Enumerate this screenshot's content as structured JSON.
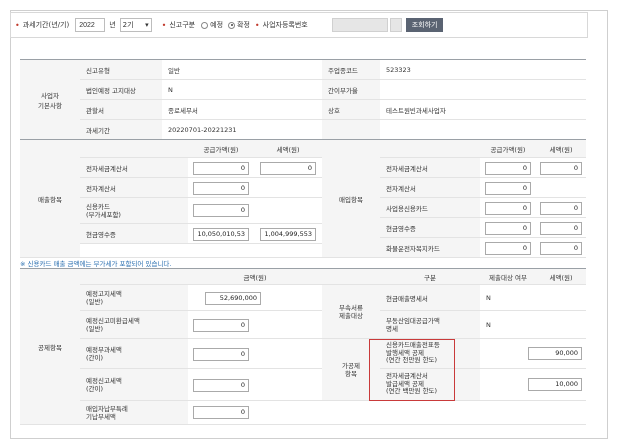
{
  "filter": {
    "period_label": "과세기간(년/기)",
    "year": "2022",
    "year_unit": "년",
    "term": "2기",
    "report_type_label": "신고구분",
    "radio_regular": "예정",
    "radio_confirm": "확정",
    "biz_no_label": "사업자등록번호",
    "search_button": "조회하기"
  },
  "basic": {
    "section_label": "사업자\n기본사항",
    "rows": [
      {
        "l1": "신고유형",
        "v1": "일반",
        "l2": "주업종코드",
        "v2": "523323"
      },
      {
        "l1": "법인예정 고지대상",
        "v1": "N",
        "l2": "간이부가율",
        "v2": ""
      },
      {
        "l1": "관할서",
        "v1": "종로세무서",
        "l2": "상호",
        "v2": "테스트원빈과세사업자"
      },
      {
        "l1": "과세기간",
        "v1": "20220701-20221231",
        "l2": "",
        "v2": ""
      }
    ]
  },
  "sales": {
    "section_label": "매출항목",
    "col_supply": "공급가액(원)",
    "col_tax": "세액(원)",
    "rows": [
      {
        "label": "전자세금계산서",
        "supply": "0",
        "tax": "0"
      },
      {
        "label": "전자계산서",
        "supply": "0",
        "tax": ""
      },
      {
        "label": "신용카드\n(부가세포함)",
        "supply": "0",
        "tax": ""
      },
      {
        "label": "현금영수증",
        "supply": "10,050,010,53",
        "tax": "1,004,999,553"
      }
    ]
  },
  "purchase": {
    "section_label": "매입항목",
    "col_supply": "공급가액(원)",
    "col_tax": "세액(원)",
    "rows": [
      {
        "label": "전자세금계산서",
        "supply": "0",
        "tax": "0"
      },
      {
        "label": "전자계산서",
        "supply": "0",
        "tax": ""
      },
      {
        "label": "사업용신용카드",
        "supply": "0",
        "tax": "0"
      },
      {
        "label": "현금영수증",
        "supply": "0",
        "tax": "0"
      },
      {
        "label": "화물운전자복지카드",
        "supply": "0",
        "tax": "0"
      }
    ]
  },
  "note": "※ 신용카드 매출 금액에는 부가세가 포함되어 있습니다.",
  "deduction": {
    "section_label": "공제항목",
    "col_amount": "금액(원)",
    "rows": [
      {
        "label": "예정고지세액\n(일반)",
        "value": "52,690,000"
      },
      {
        "label": "예정신고미환급세액\n(일반)",
        "value": "0"
      },
      {
        "label": "예정부과세액\n(간이)",
        "value": "0"
      },
      {
        "label": "예정신고세액\n(간이)",
        "value": "0"
      },
      {
        "label": "매입자납부특례\n기납부세액",
        "value": "0"
      }
    ],
    "col_category": "구분",
    "col_submit": "제출대상 여부",
    "col_tax": "세액(원)",
    "attach_label": "부속서류\n제출대상",
    "attach_rows": [
      {
        "label": "현금매출명세서",
        "value": "N"
      },
      {
        "label": "부동산임대공급가액\n명세",
        "value": "N"
      }
    ],
    "simple_label": "가공제\n항목",
    "simple_rows": [
      {
        "label": "신용카드매출전표등\n발행세액 공제\n(연간 천만원 한도)",
        "value": "90,000"
      },
      {
        "label": "전자세금계산서\n발급세액 공제\n(연간 백만원 한도)",
        "value": "10,000"
      }
    ]
  }
}
